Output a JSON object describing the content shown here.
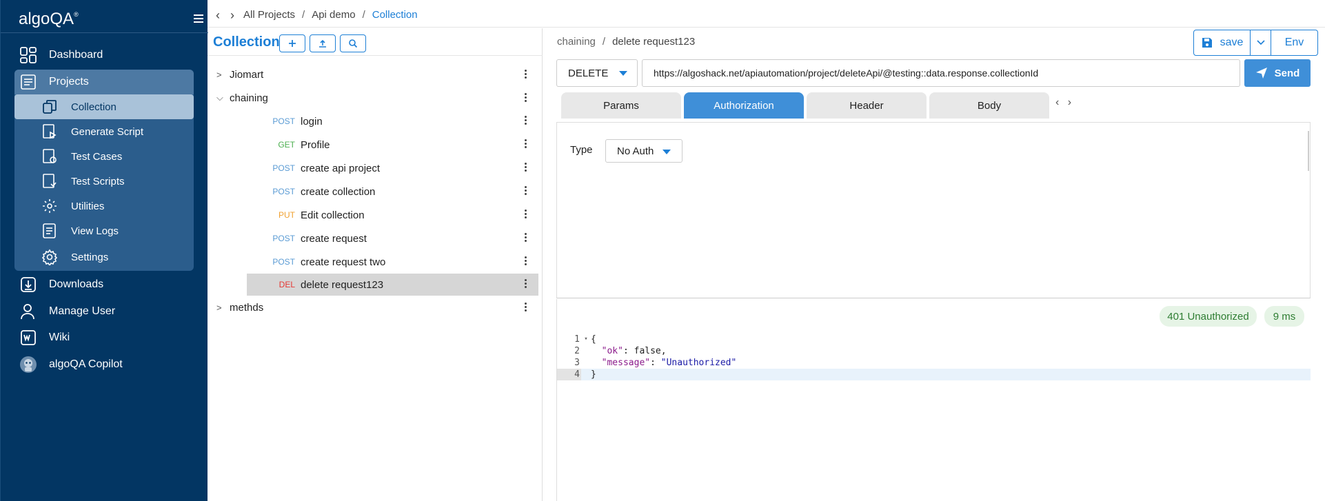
{
  "sidebar": {
    "logo": "algoQA",
    "logo_mark": "®",
    "items": [
      {
        "label": "Dashboard",
        "icon": "dashboard-icon"
      },
      {
        "label": "Projects",
        "icon": "projects-icon"
      },
      {
        "label": "Downloads",
        "icon": "download-icon"
      },
      {
        "label": "Manage User",
        "icon": "user-icon"
      },
      {
        "label": "Wiki",
        "icon": "wiki-icon"
      },
      {
        "label": "algoQA Copilot",
        "icon": "copilot-icon"
      }
    ],
    "project_sub": [
      {
        "label": "Collection",
        "icon": "collection-icon"
      },
      {
        "label": "Generate Script",
        "icon": "generate-script-icon"
      },
      {
        "label": "Test Cases",
        "icon": "test-cases-icon"
      },
      {
        "label": "Test Scripts",
        "icon": "test-scripts-icon"
      },
      {
        "label": "Utilities",
        "icon": "utilities-icon"
      },
      {
        "label": "View Logs",
        "icon": "view-logs-icon"
      },
      {
        "label": "Settings",
        "icon": "settings-icon"
      }
    ]
  },
  "breadcrumb": {
    "items": [
      "All Projects",
      "Api demo",
      "Collection"
    ],
    "sep": "/"
  },
  "collection": {
    "title": "Collection",
    "folders": [
      {
        "name": "Jiomart",
        "expanded": false
      },
      {
        "name": "chaining",
        "expanded": true
      },
      {
        "name": "methds",
        "expanded": false
      }
    ],
    "requests": [
      {
        "method": "POST",
        "name": "login"
      },
      {
        "method": "GET",
        "name": "Profile"
      },
      {
        "method": "POST",
        "name": "create api project"
      },
      {
        "method": "POST",
        "name": "create collection"
      },
      {
        "method": "PUT",
        "name": "Edit collection"
      },
      {
        "method": "POST",
        "name": "create request"
      },
      {
        "method": "POST",
        "name": "create request two"
      },
      {
        "method": "DEL",
        "name": "delete request123"
      }
    ]
  },
  "request": {
    "breadcrumb": [
      "chaining",
      "delete request123"
    ],
    "save_label": "save",
    "env_label": "Env",
    "method": "DELETE",
    "url": "https://algoshack.net/apiautomation/project/deleteApi/@testing::data.response.collectionId",
    "send_label": "Send",
    "tabs": [
      "Params",
      "Authorization",
      "Header",
      "Body"
    ],
    "active_tab": "Authorization",
    "tab_nav": "‹ ›",
    "auth": {
      "type_label": "Type",
      "type_value": "No Auth"
    }
  },
  "response": {
    "status": "401 Unauthorized",
    "time": "9 ms",
    "lines": [
      {
        "n": "1",
        "text": "{"
      },
      {
        "n": "2",
        "key": "\"ok\"",
        "val": "false,"
      },
      {
        "n": "3",
        "key": "\"message\"",
        "val": "\"Unauthorized\""
      },
      {
        "n": "4",
        "text": "}"
      }
    ]
  },
  "colors": {
    "sidebar_bg": "#033663",
    "accent": "#1d7fd6",
    "tab_active": "#3f8fd8",
    "status_ok_bg": "#e6f4e6",
    "status_text": "#2e7d32"
  }
}
